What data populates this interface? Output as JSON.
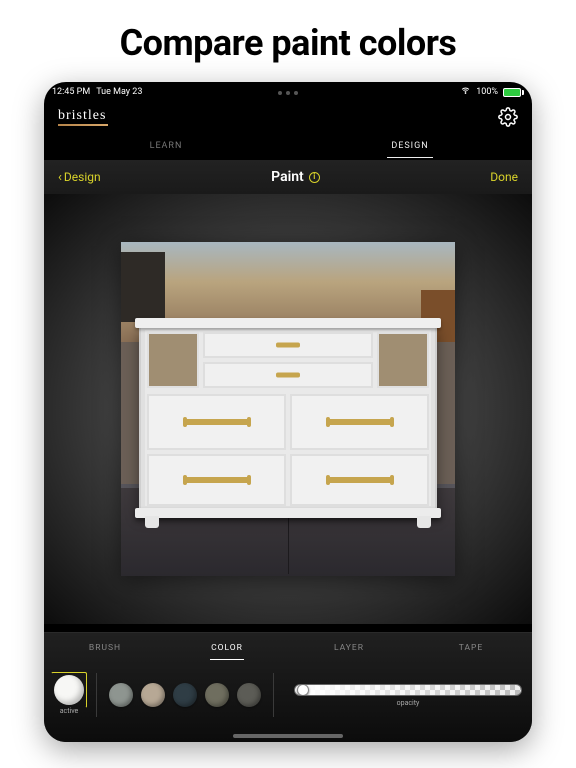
{
  "page": {
    "heading": "Compare paint colors"
  },
  "status": {
    "time": "12:45 PM",
    "date": "Tue May 23",
    "battery_pct": "100%"
  },
  "app": {
    "brand": "bristles"
  },
  "top_tabs": [
    {
      "label": "LEARN",
      "active": false
    },
    {
      "label": "DESIGN",
      "active": true
    }
  ],
  "editor": {
    "back_label": "Design",
    "title": "Paint",
    "done_label": "Done"
  },
  "tool_tabs": [
    {
      "label": "BRUSH",
      "active": false
    },
    {
      "label": "COLOR",
      "active": true
    },
    {
      "label": "LAYER",
      "active": false
    },
    {
      "label": "TAPE",
      "active": false
    }
  ],
  "color_panel": {
    "active_label": "active",
    "active_color": "#f7f7f5",
    "swatches": [
      "#8e9590",
      "#b7a895",
      "#2f3d45",
      "#6f6e5f",
      "#5c5c56"
    ],
    "opacity_label": "opacity"
  }
}
